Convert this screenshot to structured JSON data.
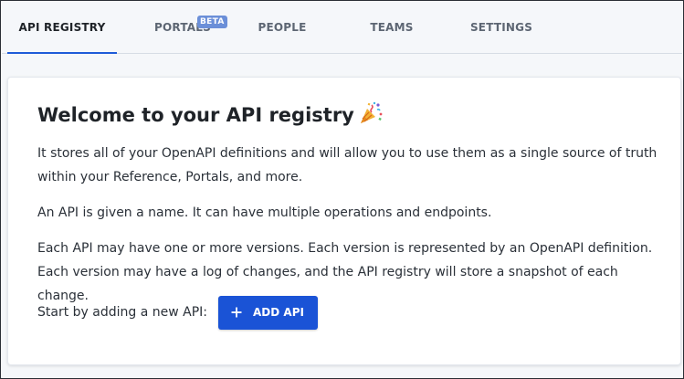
{
  "tabs": [
    {
      "label": "API REGISTRY",
      "active": true
    },
    {
      "label": "PORTALS",
      "active": false,
      "badge": "BETA"
    },
    {
      "label": "PEOPLE",
      "active": false
    },
    {
      "label": "TEAMS",
      "active": false
    },
    {
      "label": "SETTINGS",
      "active": false
    }
  ],
  "welcome": {
    "title": "Welcome to your API registry",
    "title_icon": "party-popper-icon",
    "paragraphs": [
      "It stores all of your OpenAPI definitions and will allow you to use them as a single source of truth within your Reference, Portals, and more.",
      "An API is given a name. It can have multiple operations and endpoints.",
      "Each API may have one or more versions. Each version is represented by an OpenAPI definition. Each version may have a log of changes, and the API registry will store a snapshot of each change."
    ],
    "cta_label": "Start by adding a new API:",
    "add_button_label": "ADD API",
    "add_button_icon": "plus-icon"
  },
  "colors": {
    "accent": "#1a53d6",
    "tab_indicator": "#1e5bd8",
    "beta_badge": "#6b8fd8",
    "background": "#f5f7fa"
  }
}
